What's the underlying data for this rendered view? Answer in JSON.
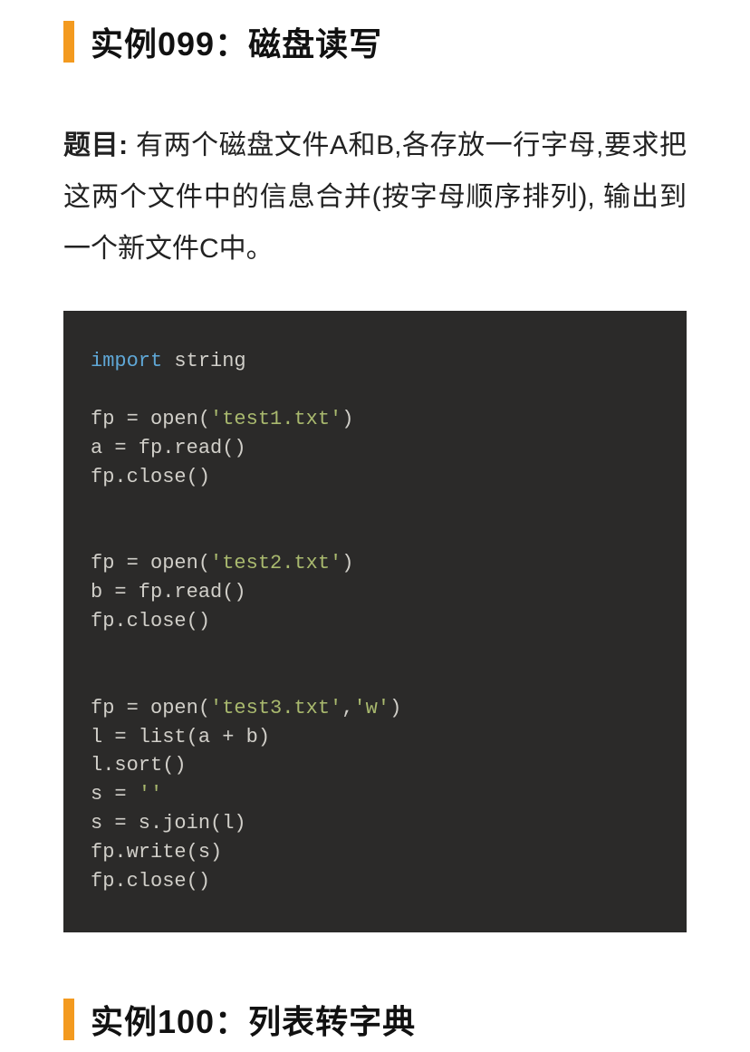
{
  "example099": {
    "heading": "实例099：磁盘读写",
    "problem_label": "题目:",
    "problem_text": " 有两个磁盘文件A和B,各存放一行字母,要求把这两个文件中的信息合并(按字母顺序排列), 输出到一个新文件C中。",
    "code": {
      "kw_import": "import",
      "sp1": " string",
      "blank": "",
      "l2a": "fp = open(",
      "str_test1": "'test1.txt'",
      "l2b": ")",
      "l3": "a = fp.read()",
      "l4": "fp.close()",
      "l6a": "fp = open(",
      "str_test2": "'test2.txt'",
      "l6b": ")",
      "l7": "b = fp.read()",
      "l8": "fp.close()",
      "l10a": "fp = open(",
      "str_test3": "'test3.txt'",
      "l10b": ",",
      "str_w": "'w'",
      "l10c": ")",
      "l11": "l = list(a + b)",
      "l12": "l.sort()",
      "l13a": "s = ",
      "str_empty": "''",
      "l14": "s = s.join(l)",
      "l15": "fp.write(s)",
      "l16": "fp.close()"
    }
  },
  "example100": {
    "heading": "实例100：列表转字典"
  }
}
